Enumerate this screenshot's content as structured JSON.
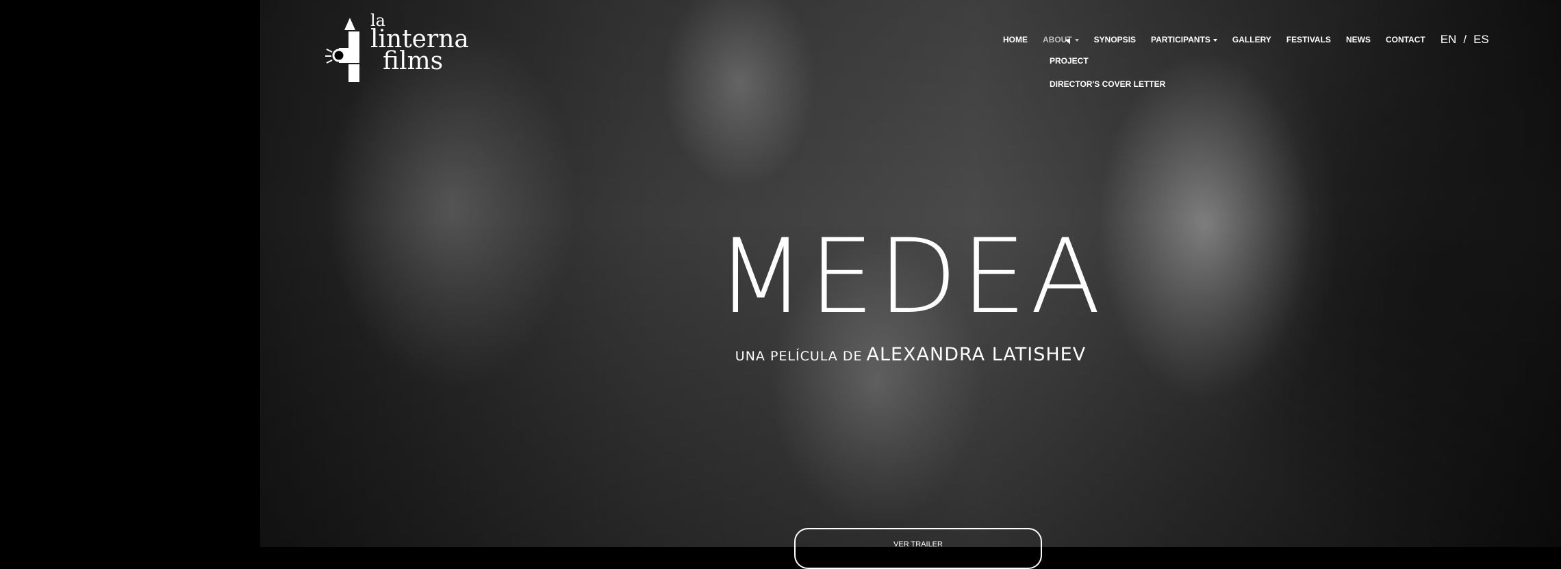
{
  "brand": {
    "logo_line1": "la",
    "logo_line2": "linterna",
    "logo_line3": "films"
  },
  "nav": {
    "items": [
      {
        "label": "HOME"
      },
      {
        "label": "ABOUT"
      },
      {
        "label": "SYNOPSIS"
      },
      {
        "label": "PARTICIPANTS"
      },
      {
        "label": "GALLERY"
      },
      {
        "label": "FESTIVALS"
      },
      {
        "label": "NEWS"
      },
      {
        "label": "CONTACT"
      }
    ],
    "lang_en": "EN",
    "lang_sep": "/",
    "lang_es": "ES"
  },
  "about_dropdown": {
    "items": [
      {
        "label": "PROJECT"
      },
      {
        "label": "DIRECTOR'S COVER LETTER"
      }
    ]
  },
  "hero": {
    "title": "MEDEA",
    "subtitle_small": "UNA PELÍCULA DE",
    "subtitle_name": "ALEXANDRA LATISHEV",
    "trailer_label": "VER TRAILER"
  },
  "colors": {
    "background": "#000000",
    "text": "#ffffff",
    "nav_active": "#bdbdbd"
  }
}
